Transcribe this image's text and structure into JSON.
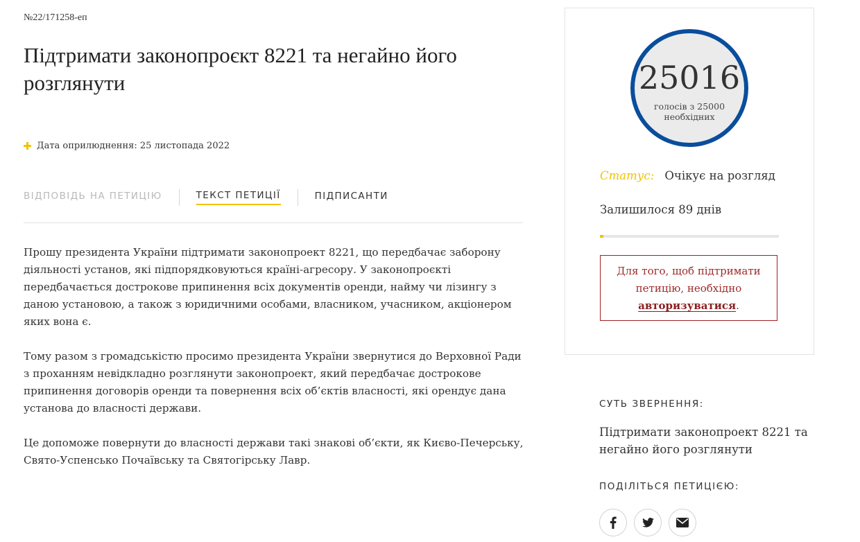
{
  "petition": {
    "number": "№22/171258-еп",
    "title": "Підтримати законопроєкт 8221 та негайно його розглянути",
    "published": "Дата оприлюднення: 25 листопада 2022"
  },
  "tabs": [
    {
      "label": "Відповідь на петицію",
      "state": "disabled"
    },
    {
      "label": "Текст петиції",
      "state": "active"
    },
    {
      "label": "Підписанти",
      "state": "normal"
    }
  ],
  "body": {
    "paragraphs": [
      "Прошу президента України підтримати законопроект 8221, що передбачає заборону діяльності установ, які підпорядковуються країні-агресору. У законопроєкті передбачається дострокове припинення всіх документів оренди, найму чи лізингу з даною установою, а також з юридичними особами, власником, учасником, акціонером яких вона є.",
      "Тому разом з громадськістю просимо президента України звернутися до Верховної Ради з проханням невідкладно розглянути законопроект, який передбачає дострокове припинення договорів оренди та повернення всіх об’єктів власності, які орендує дана установа до власності держави.",
      "Це допоможе повернути до власності держави такі знакові об’єкти, як Києво-Печерську, Свято-Успенсько Почаївську та Святогірську Лавр."
    ]
  },
  "sidebar": {
    "votes": "25016",
    "votes_caption_line1": "голосів з 25000",
    "votes_caption_line2": "необхідних",
    "status_label": "Статус:",
    "status_value": "Очікує на розгляд",
    "remaining": "Залишилося 89 днів",
    "time_progress_fraction": 0.02,
    "auth_text_before": "Для того, щоб підтримати петицію, необхідно ",
    "auth_link": "авторизуватися",
    "auth_text_after": ".",
    "summary_heading": "СУТЬ ЗВЕРНЕННЯ:",
    "summary_text": "Підтримати законопроект 8221 та негайно його розглянути",
    "share_heading": "ПОДІЛІТЬСЯ ПЕТИЦІЄЮ:",
    "share_icons": [
      "facebook-icon",
      "twitter-icon",
      "email-icon"
    ]
  },
  "colors": {
    "accent_yellow": "#f2c200",
    "counter_ring": "#0a4d9c",
    "auth_red": "#a02020"
  }
}
